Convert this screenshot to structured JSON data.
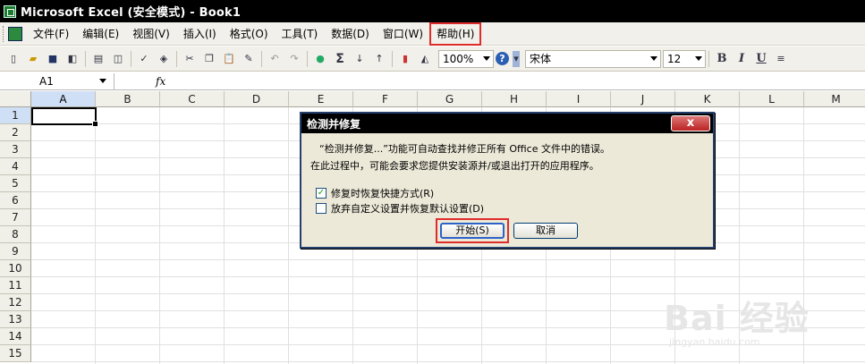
{
  "window": {
    "title": "Microsoft Excel (安全模式) - Book1"
  },
  "menu": {
    "items": [
      "文件(F)",
      "编辑(E)",
      "视图(V)",
      "插入(I)",
      "格式(O)",
      "工具(T)",
      "数据(D)",
      "窗口(W)",
      "帮助(H)"
    ],
    "highlighted": "帮助(H)"
  },
  "toolbar": {
    "zoom": "100%",
    "font_name": "宋体",
    "font_size": "12",
    "bold": "B",
    "italic": "I",
    "underline": "U",
    "sigma": "Σ"
  },
  "formula_bar": {
    "name_box": "A1",
    "fx": "fx"
  },
  "sheet": {
    "columns": [
      "A",
      "B",
      "C",
      "D",
      "E",
      "F",
      "G",
      "H",
      "I",
      "J",
      "K",
      "L",
      "M"
    ],
    "rows": [
      "1",
      "2",
      "3",
      "4",
      "5",
      "6",
      "7",
      "8",
      "9",
      "10",
      "11",
      "12",
      "13",
      "14",
      "15"
    ],
    "active_cell": "A1"
  },
  "dialog": {
    "title": "检测并修复",
    "close": "x",
    "line1": "“检测并修复...”功能可自动查找并修正所有 Office 文件中的错误。",
    "line2": "在此过程中，可能会要求您提供安装源并/或退出打开的应用程序。",
    "opt1": {
      "label": "修复时恢复快捷方式(R)",
      "checked": true
    },
    "opt2": {
      "label": "放弃自定义设置并恢复默认设置(D)",
      "checked": false
    },
    "start_button": "开始(S)",
    "cancel_button": "取消"
  },
  "watermark": {
    "main": "Bai 经验",
    "sub": "jingyan.baidu.com"
  }
}
